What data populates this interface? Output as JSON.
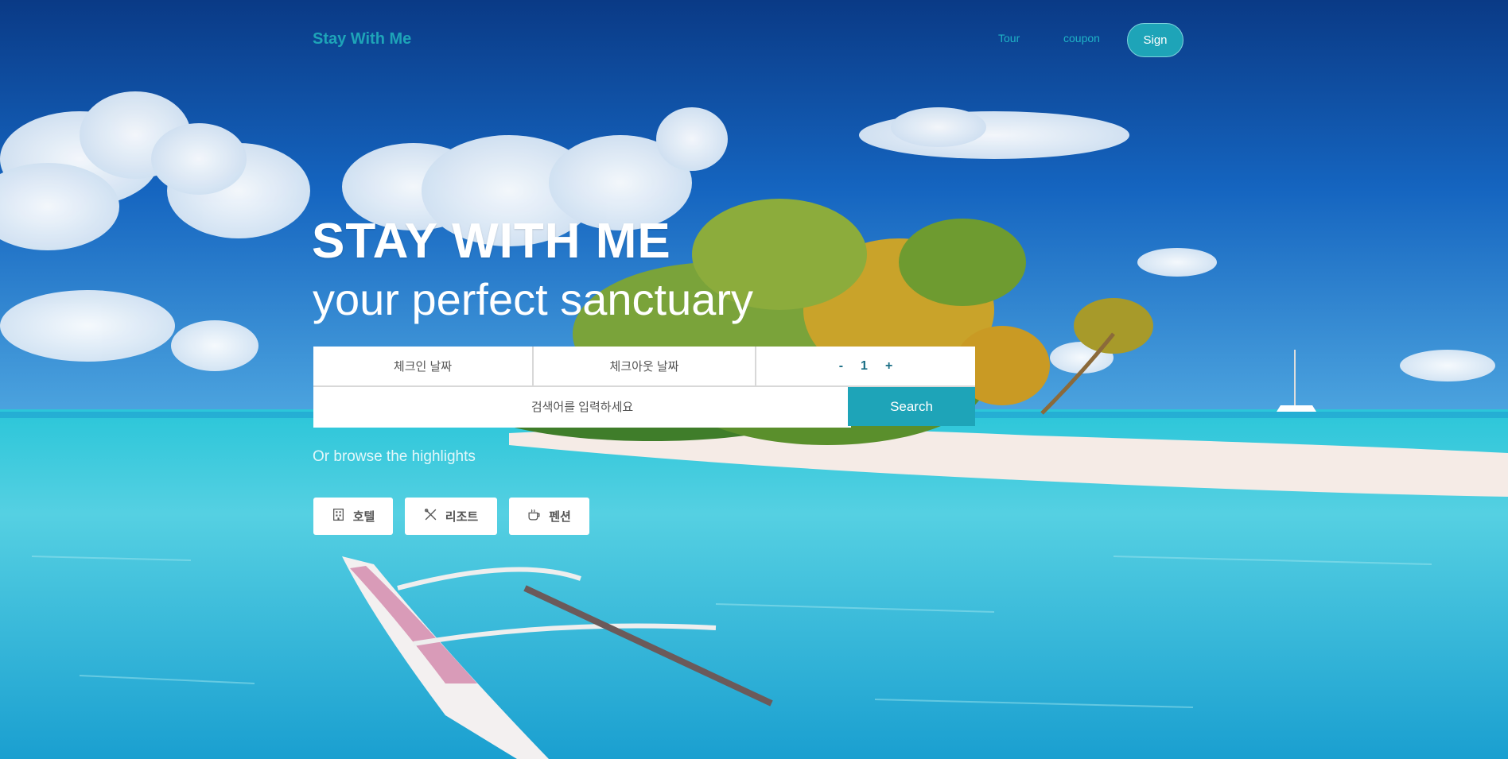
{
  "nav": {
    "brand": "Stay With Me",
    "links": [
      "Tour",
      "coupon"
    ],
    "sign_label": "Sign"
  },
  "hero": {
    "title": "STAY WITH ME",
    "subtitle": "your perfect sanctuary"
  },
  "search": {
    "checkin_label": "체크인 날짜",
    "checkout_label": "체크아웃 날짜",
    "guests": {
      "minus": "-",
      "count": "1",
      "plus": "+"
    },
    "keyword_placeholder": "검색어를 입력하세요",
    "button_label": "Search"
  },
  "browse_text": "Or browse the highlights",
  "categories": [
    {
      "label": "호텔",
      "icon": "building-icon"
    },
    {
      "label": "리조트",
      "icon": "utensils-icon"
    },
    {
      "label": "펜션",
      "icon": "coffee-cup-icon"
    }
  ],
  "colors": {
    "accent": "#1ea4b8",
    "sky_top": "#0a3f8c",
    "sea": "#35c0d8"
  }
}
